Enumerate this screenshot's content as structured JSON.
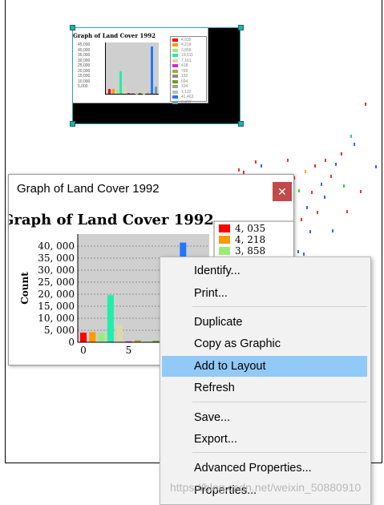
{
  "thumbnail": {
    "title": "Graph of Land Cover 1992",
    "yticks": [
      "45,000",
      "40,000",
      "35,000",
      "30,000",
      "25,000",
      "20,000",
      "15,000",
      "10,000",
      "5,000"
    ],
    "ylabel": "Count",
    "xticks": [
      "0",
      "5",
      "10"
    ],
    "legend_values": [
      "4,035",
      "4,218",
      "3,858",
      "19,611",
      "7,161",
      "418",
      "799",
      "150",
      "594",
      "104",
      "1,122",
      "41,463",
      "6,457"
    ]
  },
  "graph_window": {
    "title": "Graph of Land Cover 1992",
    "close_label": "✕"
  },
  "chart_data": {
    "type": "bar",
    "title": "Graph of Land Cover 1992",
    "ylabel": "Count",
    "xlabel": "",
    "ylim": [
      0,
      45000
    ],
    "yticks": [
      0,
      5000,
      10000,
      15000,
      20000,
      25000,
      30000,
      35000,
      40000
    ],
    "ytick_labels": [
      "0",
      "5, 000",
      "10, 000",
      "15, 000",
      "20, 000",
      "25, 000",
      "30, 000",
      "35, 000",
      "40, 000"
    ],
    "xticks": [
      0,
      5
    ],
    "x": [
      0,
      1,
      2,
      3,
      4,
      5,
      6,
      7,
      8,
      9,
      10,
      11,
      12
    ],
    "values": [
      4035,
      4218,
      3858,
      19611,
      7161,
      418,
      799,
      150,
      594,
      104,
      1122,
      41463,
      6457
    ],
    "colors": [
      "#ff0000",
      "#ff9900",
      "#99ee77",
      "#22eeaa",
      "#ddd8aa",
      "#dd22dd",
      "#aaaa22",
      "#888888",
      "#779922",
      "#99aa88",
      "#bbbbbb",
      "#2277ff",
      "#7799bb"
    ],
    "legend": [
      {
        "color": "#ff0000",
        "label": "4, 035"
      },
      {
        "color": "#ff9900",
        "label": "4, 218"
      },
      {
        "color": "#99ee77",
        "label": "3, 858"
      }
    ],
    "grid": true
  },
  "context_menu": {
    "items": [
      {
        "label": "Identify..."
      },
      {
        "label": "Print..."
      },
      {
        "label": "Duplicate"
      },
      {
        "label": "Copy as Graphic"
      },
      {
        "label": "Add to Layout"
      },
      {
        "label": "Refresh"
      },
      {
        "label": "Save..."
      },
      {
        "label": "Export..."
      },
      {
        "label": "Advanced Properties..."
      },
      {
        "label": "Properties..."
      }
    ],
    "highlighted": "Add to Layout"
  },
  "watermark": "https://blog.csdn.net/weixin_50880910"
}
